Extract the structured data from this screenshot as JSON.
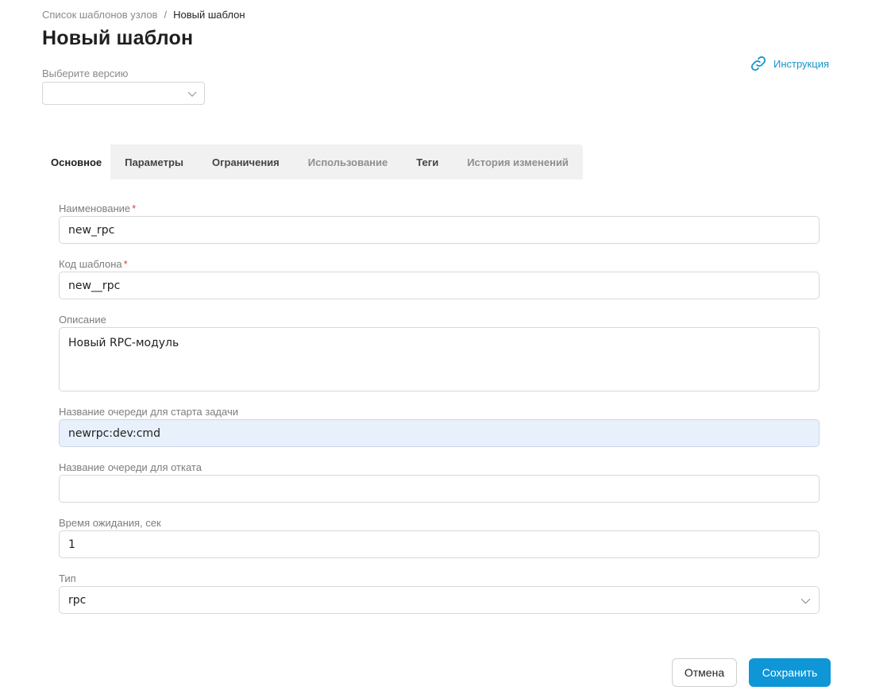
{
  "breadcrumb": {
    "parent": "Список шаблонов узлов",
    "separator": "/",
    "current": "Новый шаблон"
  },
  "page_title": "Новый шаблон",
  "help_link": {
    "label": "Инструкция",
    "icon": "link-icon",
    "color": "#1a93c8"
  },
  "version": {
    "label": "Выберите версию",
    "value": ""
  },
  "tabs": [
    {
      "label": "Основное",
      "active": true
    },
    {
      "label": "Параметры"
    },
    {
      "label": "Ограничения"
    },
    {
      "label": "Использование",
      "disabled": true
    },
    {
      "label": "Теги"
    },
    {
      "label": "История изменений",
      "disabled": true
    }
  ],
  "form": {
    "name": {
      "label": "Наименование",
      "required": "*",
      "value": "new_rpc"
    },
    "code": {
      "label": "Код шаблона",
      "required": "*",
      "value": "new__rpc"
    },
    "description": {
      "label": "Описание",
      "value": "Новый RPC-модуль"
    },
    "start_queue": {
      "label": "Название очереди для старта задачи",
      "value": "newrpc:dev:cmd"
    },
    "rollback_queue": {
      "label": "Название очереди для отката",
      "value": ""
    },
    "timeout": {
      "label": "Время ожидания, сек",
      "value": "1"
    },
    "type": {
      "label": "Тип",
      "value": "rpc"
    }
  },
  "buttons": {
    "cancel": "Отмена",
    "save": "Сохранить",
    "save_color": "#0f96d6"
  }
}
